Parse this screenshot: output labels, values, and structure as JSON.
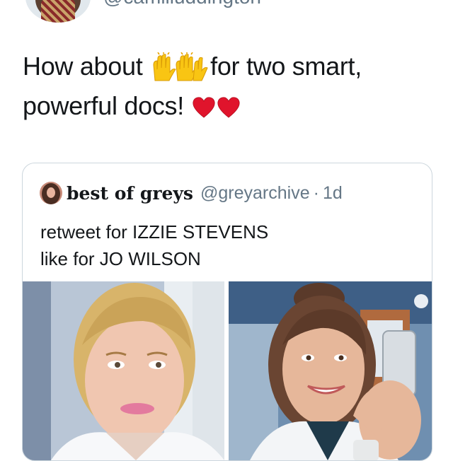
{
  "author": {
    "handle": "@camilluddington",
    "avatar_icon": "profile-photo"
  },
  "tweet": {
    "text_before": "How about ",
    "text_after": "for two smart, powerful docs! ",
    "emojis": [
      "raising-hands-icon",
      "heart-icon"
    ]
  },
  "quoted_tweet": {
    "name": "best of greys",
    "handle": "@greyarchive",
    "separator": "·",
    "time": "1d",
    "lines": [
      "retweet for IZZIE STEVENS",
      "like for JO WILSON"
    ],
    "media": [
      {
        "name": "izzie-stevens-photo"
      },
      {
        "name": "jo-wilson-photo"
      }
    ]
  },
  "colors": {
    "text": "#14171a",
    "secondary": "#657786",
    "border": "#ccd6dd",
    "heart": "#e0142c",
    "emoji_yellow": "#f9c513"
  }
}
